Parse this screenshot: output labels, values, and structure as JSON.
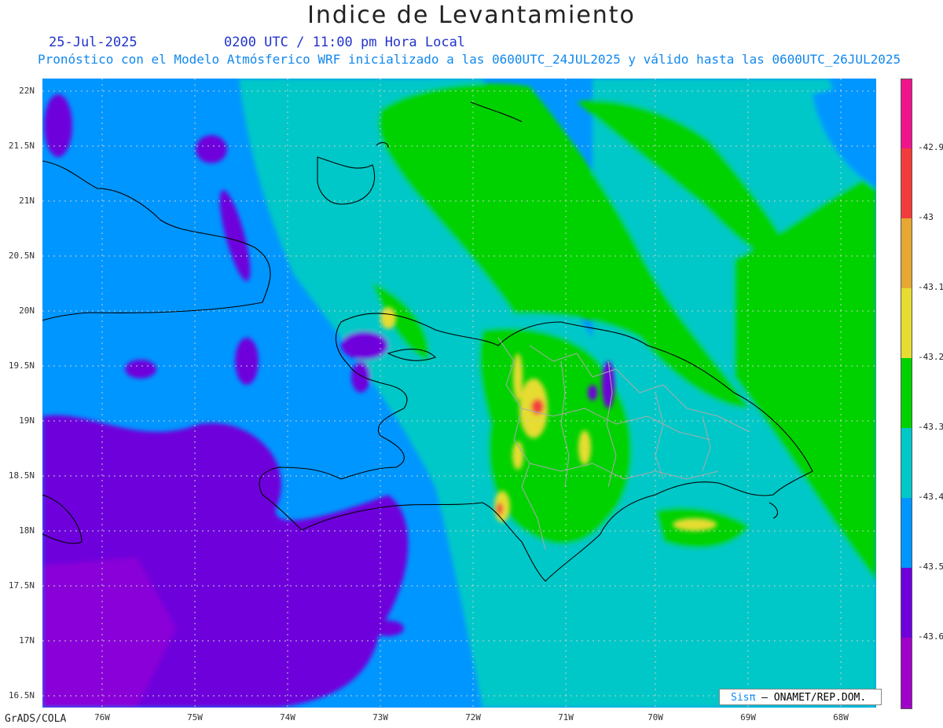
{
  "title": "Indice de Levantamiento",
  "date": "25-Jul-2025",
  "time": "0200 UTC / 11:00 pm Hora Local",
  "description": "Pronóstico con el Modelo Atmósferico WRF inicializado a las 0600UTC_24JUL2025 y válido hasta las  0600UTC_26JUL2025",
  "lat_labels": [
    "22N",
    "21.5N",
    "21N",
    "20.5N",
    "20N",
    "19.5N",
    "19N",
    "18.5N",
    "18N",
    "17.5N",
    "17N",
    "16.5N"
  ],
  "lon_labels": [
    "76W",
    "75W",
    "74W",
    "73W",
    "72W",
    "71W",
    "70W",
    "69W",
    "68W"
  ],
  "colorbar": {
    "labels": [
      "-42.9",
      "-43",
      "-43.1",
      "-43.2",
      "-43.3",
      "-43.4",
      "-43.5",
      "-43.6"
    ],
    "colors": [
      "#f0148c",
      "#f23c3c",
      "#e6a832",
      "#e6dc32",
      "#00d200",
      "#00c8c8",
      "#0096ff",
      "#6e00dc",
      "#a000c8"
    ]
  },
  "credit": {
    "brand": "Sisπ",
    "text": "– ONAMET/REP.DOM."
  },
  "footer": "GrADS/COLA"
}
